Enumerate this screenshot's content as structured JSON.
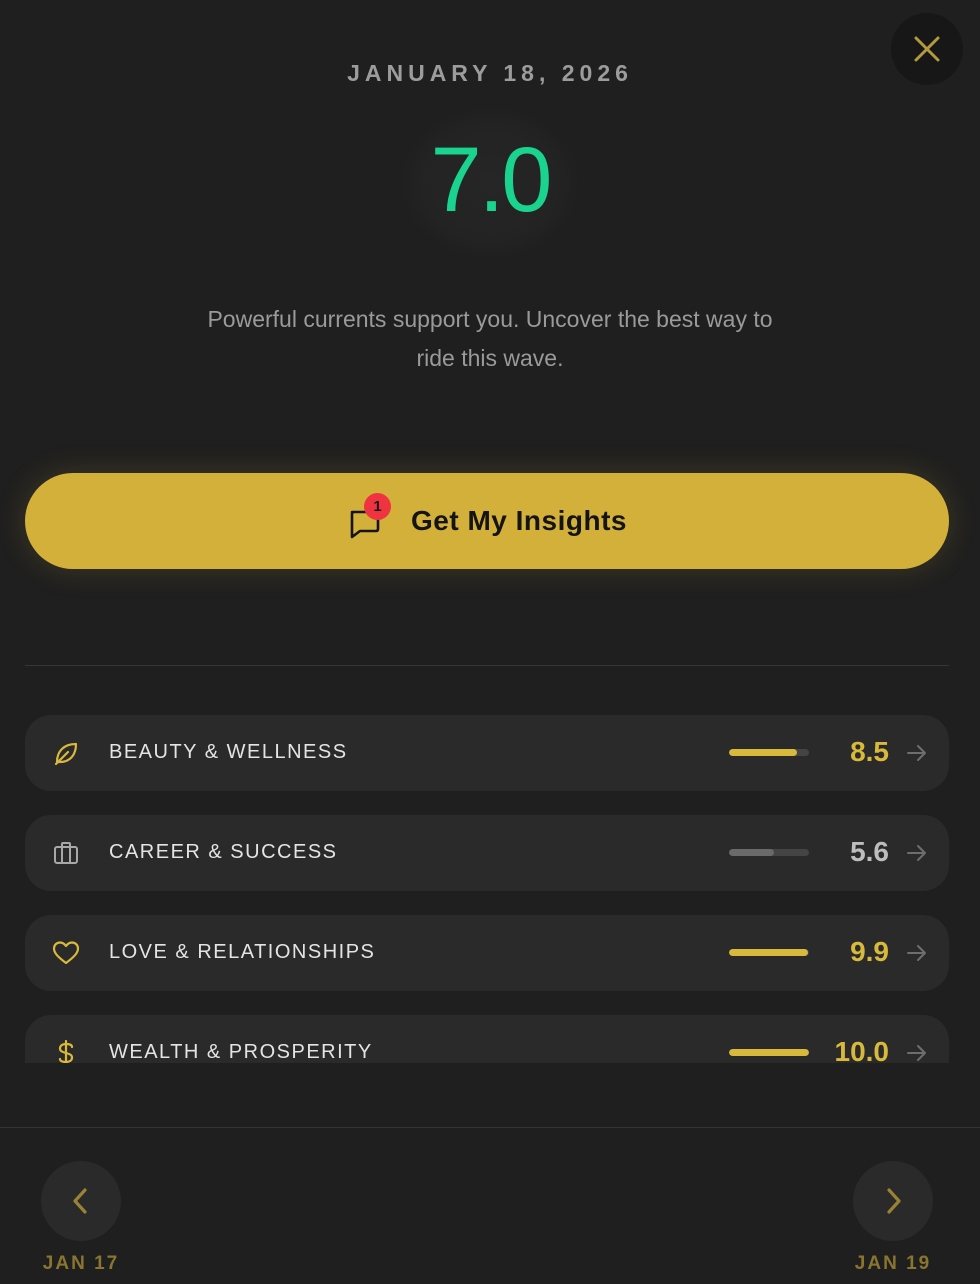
{
  "header": {
    "date": "JANUARY 18, 2026",
    "score": "7.0",
    "score_color": "#19d38f",
    "subtitle": "Powerful currents support you. Uncover the best way to ride this wave.",
    "close_icon": "close-icon"
  },
  "insights_button": {
    "label": "Get My Insights",
    "badge_count": "1",
    "icon": "chat-bubble-icon",
    "color": "#d3b03a",
    "badge_color": "#ef3341"
  },
  "categories": [
    {
      "icon": "leaf-icon",
      "label": "BEAUTY & WELLNESS",
      "value": "8.5",
      "progress": 0.85,
      "bar_color": "#d8b93c",
      "value_color": "#d8b93c"
    },
    {
      "icon": "briefcase-icon",
      "label": "CAREER & SUCCESS",
      "value": "5.6",
      "progress": 0.56,
      "bar_color": "#6a6a6a",
      "value_color": "#bdbdbd"
    },
    {
      "icon": "heart-icon",
      "label": "LOVE & RELATIONSHIPS",
      "value": "9.9",
      "progress": 0.99,
      "bar_color": "#d8b93c",
      "value_color": "#d8b93c"
    },
    {
      "icon": "dollar-icon",
      "label": "WEALTH & PROSPERITY",
      "value": "10.0",
      "progress": 1.0,
      "bar_color": "#d8b93c",
      "value_color": "#d8b93c"
    }
  ],
  "navigation": {
    "prev_label": "JAN 17",
    "next_label": "JAN 19",
    "accent": "#8a7530"
  }
}
